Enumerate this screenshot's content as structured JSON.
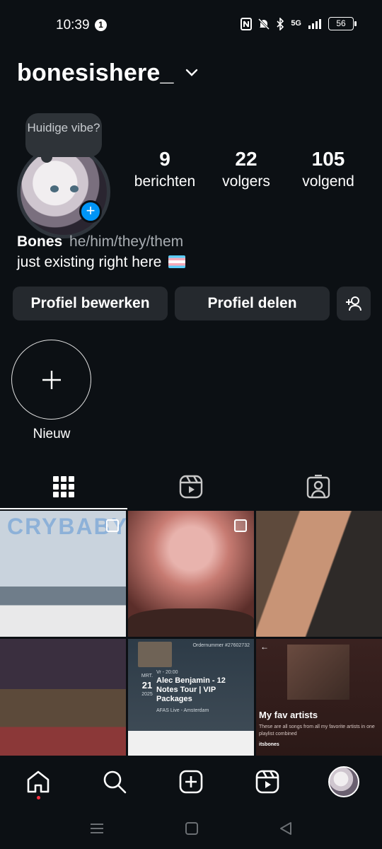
{
  "status_bar": {
    "time": "10:39",
    "notification_count": "1",
    "network": "5G",
    "battery": "56"
  },
  "header": {
    "username": "bonesishere_"
  },
  "profile": {
    "vibe_prompt": "Huidige vibe?",
    "stats": [
      {
        "value": "9",
        "label": "berichten"
      },
      {
        "value": "22",
        "label": "volgers"
      },
      {
        "value": "105",
        "label": "volgend"
      }
    ],
    "name": "Bones",
    "pronouns": "he/him/they/them",
    "bio": "just existing right here"
  },
  "actions": {
    "edit_label": "Profiel bewerken",
    "share_label": "Profiel delen"
  },
  "highlight": {
    "new_label": "Nieuw"
  },
  "posts": {
    "p1_text": "CRYBABY",
    "p5_order": "Ordernummer #27602732",
    "p5_weekday": "MRT.",
    "p5_day": "21",
    "p5_year": "2025",
    "p5_time": "Vr - 20:00",
    "p5_title": "Alec Benjamin - 12 Notes Tour | VIP Packages",
    "p5_venue": "AFAS Live - Amsterdam",
    "p6_title": "My fav artists",
    "p6_desc": "These are all songs from all my favorite artists in one playlist combined",
    "p6_user": "itsbones"
  },
  "colors": {
    "background": "#0c1014",
    "button": "#25292e",
    "accent_blue": "#0095f6",
    "notification_red": "#ff3040"
  }
}
